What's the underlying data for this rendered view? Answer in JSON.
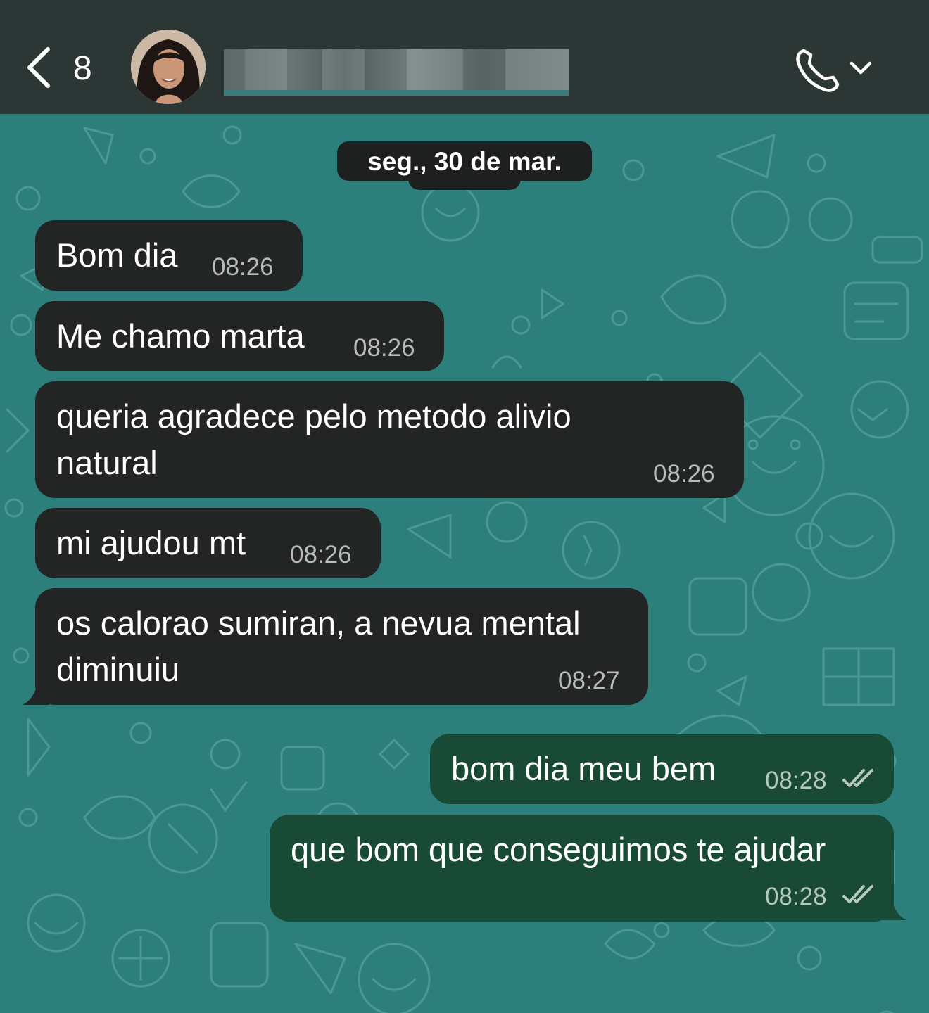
{
  "header": {
    "back_count": "8",
    "contact_name": ""
  },
  "date_chip": "seg., 30 de mar.",
  "messages": [
    {
      "dir": "in",
      "lines": [
        "Bom dia"
      ],
      "time": "08:26"
    },
    {
      "dir": "in",
      "lines": [
        "Me chamo marta"
      ],
      "time": "08:26"
    },
    {
      "dir": "in",
      "lines": [
        "queria agradece pelo metodo alivio",
        "natural"
      ],
      "time": "08:26"
    },
    {
      "dir": "in",
      "lines": [
        "mi ajudou mt"
      ],
      "time": "08:26"
    },
    {
      "dir": "in",
      "lines": [
        "os calorao sumiran, a nevua mental",
        "diminuiu"
      ],
      "time": "08:27"
    },
    {
      "dir": "out",
      "lines": [
        "bom dia meu bem"
      ],
      "time": "08:28",
      "status": "read"
    },
    {
      "dir": "out",
      "lines": [
        "que bom que conseguimos te ajudar"
      ],
      "time": "08:28",
      "status": "read"
    }
  ],
  "colors": {
    "header_bg": "#2b3635",
    "wallpaper": "#2d7f7c",
    "incoming_bubble": "#232424",
    "outgoing_bubble": "#184a35"
  },
  "icons": [
    "chevron-left-icon",
    "avatar",
    "phone-icon",
    "chevron-down-icon",
    "double-check-icon"
  ]
}
